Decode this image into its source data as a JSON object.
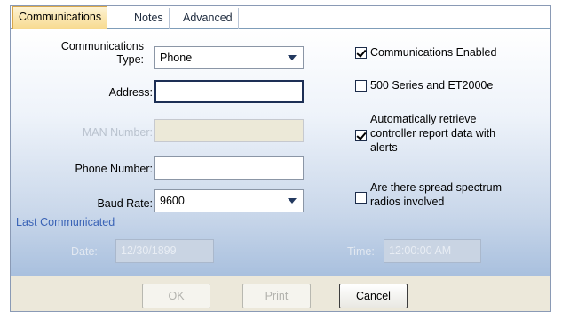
{
  "tabs": [
    {
      "label": "Communications",
      "active": true
    },
    {
      "label": "Notes",
      "active": false
    },
    {
      "label": "Advanced",
      "active": false
    }
  ],
  "form": {
    "communications_type_label_line1": "Communications",
    "communications_type_label_line2": "Type:",
    "communications_type_value": "Phone",
    "address_label": "Address:",
    "address_value": "",
    "man_number_label": "MAN Number:",
    "man_number_value": "",
    "phone_number_label": "Phone Number:",
    "phone_number_value": "",
    "baud_rate_label": "Baud Rate:",
    "baud_rate_value": "9600"
  },
  "options": {
    "communications_enabled": {
      "label": "Communications Enabled",
      "checked": true
    },
    "series_500": {
      "label": "500 Series and ET2000e",
      "checked": false
    },
    "auto_retrieve": {
      "label_line1": "Automatically retrieve",
      "label_line2": "controller report data with",
      "label_line3": "alerts",
      "checked": true
    },
    "spread_spectrum": {
      "label_line1": "Are there spread spectrum",
      "label_line2": "radios involved",
      "checked": false
    }
  },
  "last_communicated": {
    "title": "Last Communicated",
    "date_label": "Date:",
    "date_value": "12/30/1899",
    "time_label": "Time:",
    "time_value": "12:00:00 AM"
  },
  "buttons": {
    "ok": "OK",
    "print": "Print",
    "cancel": "Cancel"
  },
  "colors": {
    "active_tab": "#f7d98b",
    "panel_top": "#ffffff",
    "panel_bottom": "#a9c0de",
    "section_title": "#3a63b6"
  }
}
